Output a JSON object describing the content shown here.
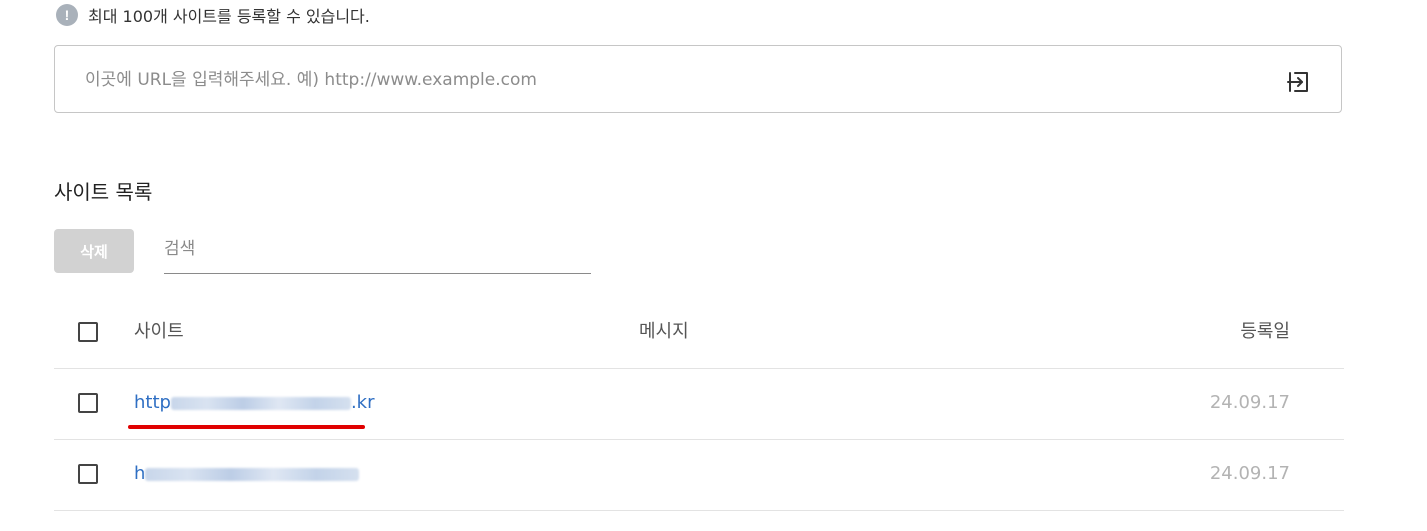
{
  "notice": {
    "icon": "info-icon",
    "icon_glyph": "!",
    "text": "최대 100개 사이트를 등록할 수 있습니다."
  },
  "url_input": {
    "placeholder": "이곳에 URL을 입력해주세요. 예) http://www.example.com",
    "value": "",
    "submit_icon": "enter-icon"
  },
  "sites": {
    "title": "사이트 목록",
    "delete_label": "삭제",
    "search_placeholder": "검색",
    "columns": {
      "site": "사이트",
      "message": "메시지",
      "date": "등록일"
    },
    "rows": [
      {
        "site_prefix": "http",
        "site_suffix": ".kr",
        "message": "",
        "date": "24.09.17"
      },
      {
        "site_prefix": "h",
        "site_suffix": "",
        "message": "",
        "date": "24.09.17"
      }
    ]
  },
  "colors": {
    "link": "#2f6fc3",
    "annotation": "#e00000",
    "disabled_button": "#d2d2d2"
  }
}
